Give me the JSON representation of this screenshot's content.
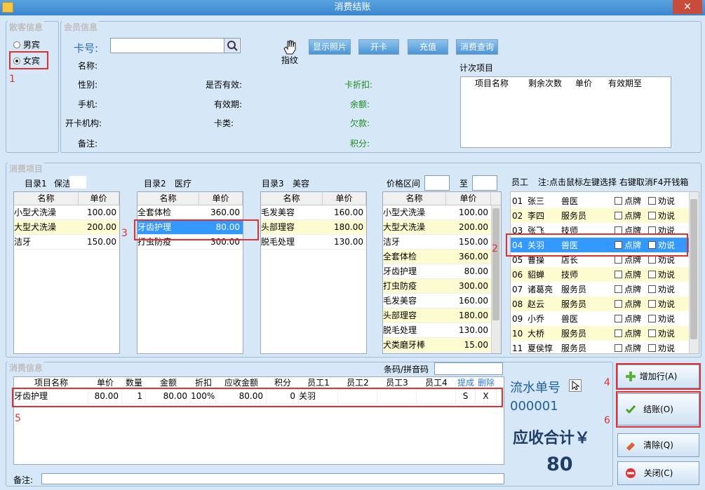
{
  "window": {
    "title": "消费结账",
    "close": "✕"
  },
  "customer_info": {
    "title": "散客信息",
    "male": "男宾",
    "female": "女宾",
    "marker": "1"
  },
  "member_info": {
    "title": "会员信息",
    "card_label": "卡号:",
    "card_value": "",
    "fingerprint": "指纹",
    "buttons": {
      "photo": "显示照片",
      "open_card": "开卡",
      "recharge": "充值",
      "query": "消费查询"
    },
    "fields": {
      "name": "名称:",
      "gender": "性别:",
      "valid": "是否有效:",
      "discount": "卡折扣:",
      "phone": "手机:",
      "expiry": "有效期:",
      "balance": "余额:",
      "open_org": "开卡机构:",
      "card_type": "卡类:",
      "debt": "欠款:",
      "note": "备注:",
      "points": "积分:"
    },
    "count_items": {
      "title": "计次项目",
      "columns": [
        "项目名称",
        "剩余次数",
        "单价",
        "有效期至"
      ]
    }
  },
  "consume_items": {
    "title": "消费项目",
    "cat1": {
      "label": "目录1",
      "value": "保洁",
      "columns": [
        "名称",
        "单价"
      ],
      "rows": [
        [
          "小型犬洗澡",
          "100.00"
        ],
        [
          "大型犬洗澡",
          "200.00"
        ],
        [
          "洁牙",
          "150.00"
        ]
      ]
    },
    "cat2": {
      "label": "目录2",
      "value": "医疗",
      "columns": [
        "名称",
        "单价"
      ],
      "rows": [
        [
          "全套体检",
          "360.00"
        ],
        [
          "牙齿护理",
          "80.00"
        ],
        [
          "打虫防疫",
          "300.00"
        ]
      ],
      "marker": "3"
    },
    "cat3": {
      "label": "目录3",
      "value": "美容",
      "columns": [
        "名称",
        "单价"
      ],
      "rows": [
        [
          "毛发美容",
          "160.00"
        ],
        [
          "头部理容",
          "180.00"
        ],
        [
          "脱毛处理",
          "130.00"
        ]
      ]
    },
    "price_range": {
      "label": "价格区间",
      "to": "至",
      "columns": [
        "名称",
        "单价"
      ],
      "rows": [
        [
          "小型犬洗澡",
          "100.00"
        ],
        [
          "大型犬洗澡",
          "200.00"
        ],
        [
          "洁牙",
          "150.00"
        ],
        [
          "全套体检",
          "360.00"
        ],
        [
          "牙齿护理",
          "80.00"
        ],
        [
          "打虫防疫",
          "300.00"
        ],
        [
          "毛发美容",
          "160.00"
        ],
        [
          "头部理容",
          "180.00"
        ],
        [
          "脱毛处理",
          "130.00"
        ],
        [
          "犬类磨牙棒",
          "15.00"
        ]
      ]
    },
    "staff": {
      "label": "员工",
      "note": "注:点击鼠标左键选择 右键取消F4开钱箱",
      "marker": "2",
      "pick": "点牌",
      "persuade": "劝说",
      "rows": [
        [
          "01",
          "张三",
          "兽医"
        ],
        [
          "02",
          "李四",
          "服务员"
        ],
        [
          "03",
          "张飞",
          "技师"
        ],
        [
          "04",
          "关羽",
          "兽医"
        ],
        [
          "05",
          "曹操",
          "店长"
        ],
        [
          "06",
          "貂蝉",
          "技师"
        ],
        [
          "07",
          "诸葛亮",
          "服务员"
        ],
        [
          "08",
          "赵云",
          "服务员"
        ],
        [
          "09",
          "小乔",
          "兽医"
        ],
        [
          "10",
          "大桥",
          "服务员"
        ],
        [
          "11",
          "夏侯惇",
          "服务员"
        ]
      ]
    }
  },
  "consume_info": {
    "title": "消费信息",
    "barcode_label": "条码/拼音码",
    "marker": "5",
    "columns": [
      "项目名称",
      "单价",
      "数量",
      "金额",
      "折扣",
      "应收金额",
      "积分",
      "员工1",
      "员工2",
      "员工3",
      "员工4",
      "提成",
      "删除"
    ],
    "rows": [
      [
        "牙齿护理",
        "80.00",
        "1",
        "80.00",
        "100%",
        "80.00",
        "0",
        "关羽",
        "",
        "",
        "",
        "S",
        "X"
      ]
    ],
    "note_label": "备注:"
  },
  "summary": {
    "serial_label": "流水单号",
    "serial": "000001",
    "total_label": "应收合计￥",
    "total": "80"
  },
  "actions": {
    "add_row": "增加行(A)",
    "checkout": "结账(O)",
    "clear": "清除(Q)",
    "close": "关闭(C)",
    "marker_add": "4",
    "marker_checkout": "6"
  }
}
